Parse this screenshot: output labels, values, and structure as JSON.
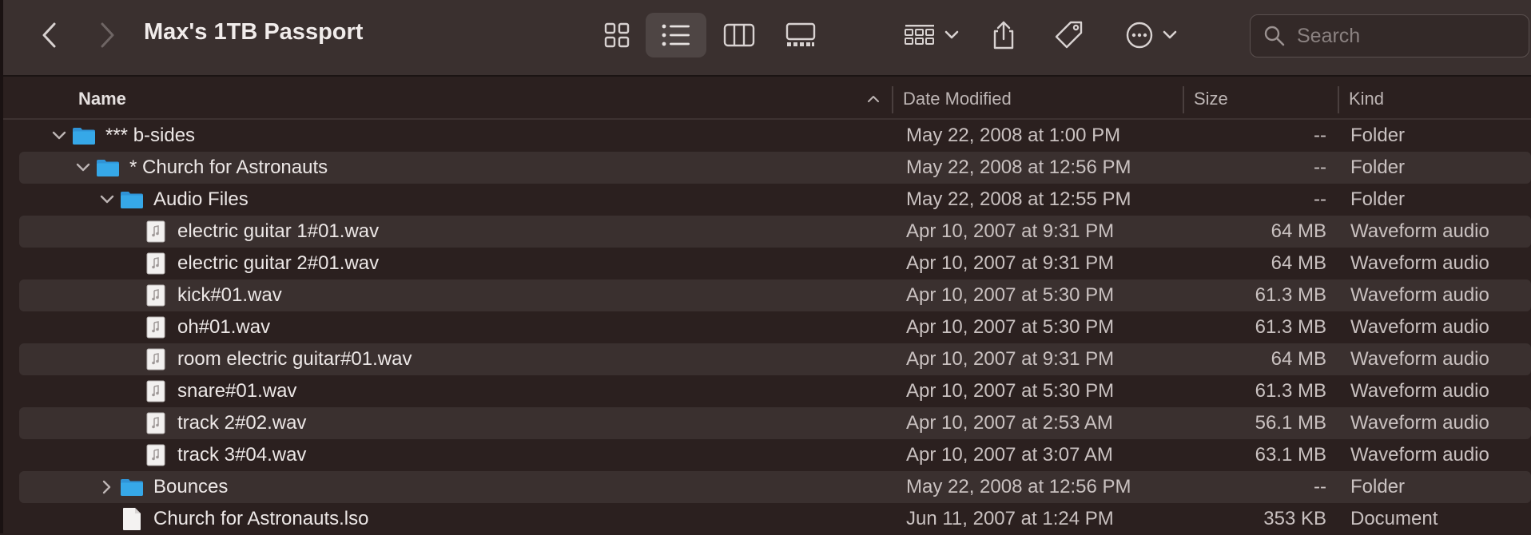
{
  "window": {
    "title": "Max's 1TB Passport"
  },
  "toolbar": {
    "back_icon": "chevron-left-icon",
    "forward_icon": "chevron-right-icon",
    "views": [
      "icon-view-icon",
      "list-view-icon",
      "column-view-icon",
      "gallery-view-icon"
    ],
    "active_view": "list",
    "search_placeholder": "Search"
  },
  "columns": {
    "name": "Name",
    "date": "Date Modified",
    "size": "Size",
    "kind": "Kind",
    "sort_indicator": "^"
  },
  "rows": [
    {
      "name": "*** b-sides",
      "date": "May 22, 2008 at 1:00 PM",
      "size": "--",
      "kind": "Folder",
      "type": "folder",
      "depth": 0,
      "expanded": true
    },
    {
      "name": "* Church for Astronauts",
      "date": "May 22, 2008 at 12:56 PM",
      "size": "--",
      "kind": "Folder",
      "type": "folder",
      "depth": 1,
      "expanded": true
    },
    {
      "name": "Audio Files",
      "date": "May 22, 2008 at 12:55 PM",
      "size": "--",
      "kind": "Folder",
      "type": "folder",
      "depth": 2,
      "expanded": true
    },
    {
      "name": "electric guitar 1#01.wav",
      "date": "Apr 10, 2007 at 9:31 PM",
      "size": "64 MB",
      "kind": "Waveform audio",
      "type": "audio",
      "depth": 3
    },
    {
      "name": "electric guitar 2#01.wav",
      "date": "Apr 10, 2007 at 9:31 PM",
      "size": "64 MB",
      "kind": "Waveform audio",
      "type": "audio",
      "depth": 3
    },
    {
      "name": "kick#01.wav",
      "date": "Apr 10, 2007 at 5:30 PM",
      "size": "61.3 MB",
      "kind": "Waveform audio",
      "type": "audio",
      "depth": 3
    },
    {
      "name": "oh#01.wav",
      "date": "Apr 10, 2007 at 5:30 PM",
      "size": "61.3 MB",
      "kind": "Waveform audio",
      "type": "audio",
      "depth": 3
    },
    {
      "name": "room electric guitar#01.wav",
      "date": "Apr 10, 2007 at 9:31 PM",
      "size": "64 MB",
      "kind": "Waveform audio",
      "type": "audio",
      "depth": 3
    },
    {
      "name": "snare#01.wav",
      "date": "Apr 10, 2007 at 5:30 PM",
      "size": "61.3 MB",
      "kind": "Waveform audio",
      "type": "audio",
      "depth": 3
    },
    {
      "name": "track 2#02.wav",
      "date": "Apr 10, 2007 at 2:53 AM",
      "size": "56.1 MB",
      "kind": "Waveform audio",
      "type": "audio",
      "depth": 3
    },
    {
      "name": "track 3#04.wav",
      "date": "Apr 10, 2007 at 3:07 AM",
      "size": "63.1 MB",
      "kind": "Waveform audio",
      "type": "audio",
      "depth": 3
    },
    {
      "name": "Bounces",
      "date": "May 22, 2008 at 12:56 PM",
      "size": "--",
      "kind": "Folder",
      "type": "folder",
      "depth": 2,
      "expanded": false
    },
    {
      "name": "Church for Astronauts.lso",
      "date": "Jun 11, 2007 at 1:24 PM",
      "size": "353 KB",
      "kind": "Document",
      "type": "document",
      "depth": 2
    }
  ],
  "colors": {
    "folder": "#36a8e8",
    "row_alt": "#3a302f",
    "background": "#2b201f"
  }
}
